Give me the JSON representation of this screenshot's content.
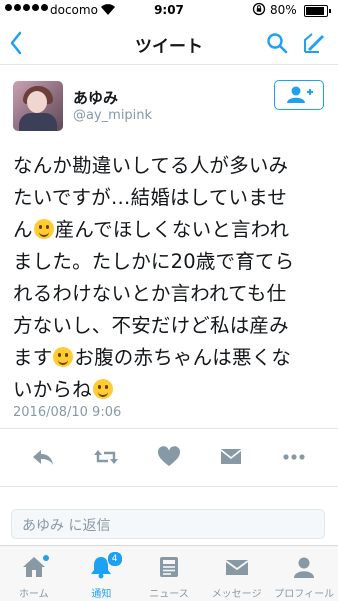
{
  "status_bar": {
    "carrier": "docomo",
    "time": "9:07",
    "battery": "80%"
  },
  "nav": {
    "title": "ツイート"
  },
  "author": {
    "name": "あゆみ",
    "handle": "@ay_mipink"
  },
  "tweet": {
    "lines": [
      [
        "なんか勘違いしてる人が多いみ"
      ],
      [
        "たいですが…結婚はしていませ"
      ],
      [
        "ん",
        "😊",
        "産んでほしくないと言われ"
      ],
      [
        "ました。たしかに20歳で育てら"
      ],
      [
        "れるわけないとか言われても仕"
      ],
      [
        "方ないし、不安だけど私は産み"
      ],
      [
        "ます",
        "😊",
        "お腹の赤ちゃんは悪くな"
      ],
      [
        "いからね",
        "☺"
      ]
    ],
    "timestamp": "2016/08/10 9:06"
  },
  "reply": {
    "placeholder": "あゆみ に返信"
  },
  "tabbar": {
    "tabs": [
      {
        "label": "ホーム",
        "icon": "home-icon"
      },
      {
        "label": "通知",
        "icon": "bell-icon",
        "badge": "4"
      },
      {
        "label": "ニュース",
        "icon": "news-icon"
      },
      {
        "label": "メッセージ",
        "icon": "envelope-icon"
      },
      {
        "label": "プロフィール",
        "icon": "person-icon"
      }
    ]
  },
  "colors": {
    "accent": "#1da1f2",
    "muted": "#8899a6",
    "text": "#14171a"
  }
}
